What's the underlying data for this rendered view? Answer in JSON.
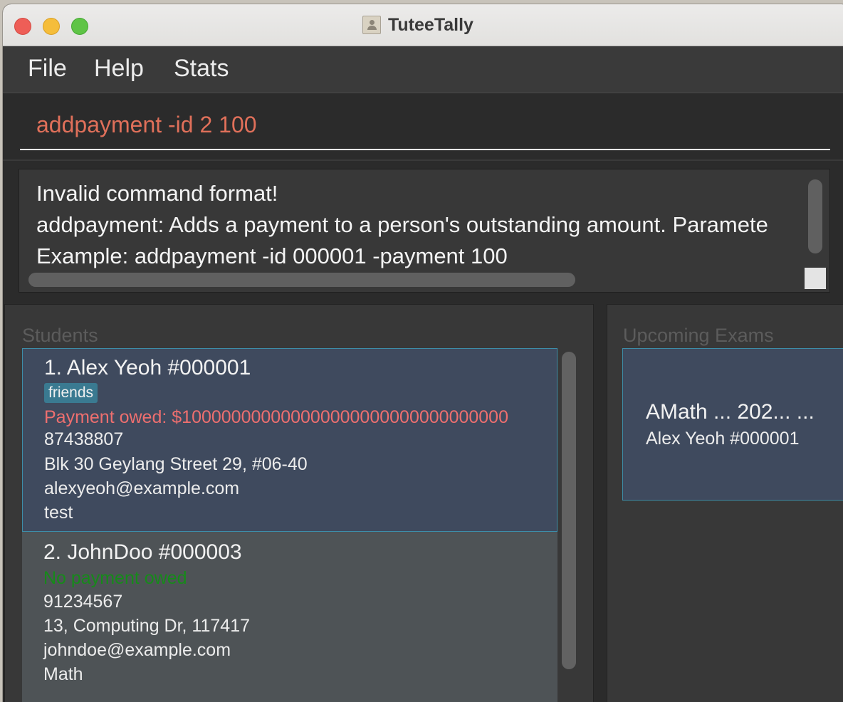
{
  "window": {
    "title": "TuteeTally"
  },
  "menu": {
    "file": "File",
    "help": "Help",
    "stats": "Stats"
  },
  "command": {
    "value": "addpayment -id 2 100"
  },
  "result": {
    "lines": [
      "Invalid command format!",
      "addpayment: Adds a payment to a person's outstanding amount. Paramete",
      "Example: addpayment -id 000001  -payment 100"
    ]
  },
  "students": {
    "label": "Students",
    "items": [
      {
        "header": "1.  Alex Yeoh   #000001",
        "tag": "friends",
        "payment": "Payment owed: $100000000000000000000000000000000",
        "phone": "87438807",
        "address": "Blk 30 Geylang Street 29, #06-40",
        "email": "alexyeoh@example.com",
        "subject": "test"
      },
      {
        "header": "2.  JohnDoo   #000003",
        "payment": "No payment owed",
        "phone": "91234567",
        "address": "13, Computing Dr, 117417",
        "email": "johndoe@example.com",
        "subject": "Math"
      }
    ]
  },
  "exams": {
    "label": "Upcoming Exams",
    "items": [
      {
        "title": "AMath ...   202...    ...",
        "student": "Alex Yeoh   #000001"
      }
    ]
  },
  "colors": {
    "accent_border": "#3d8da8",
    "command_text": "#e0705a",
    "owed": "#ee6f6f",
    "no_owed": "#168a1a",
    "tag_bg": "#3a7a91"
  }
}
